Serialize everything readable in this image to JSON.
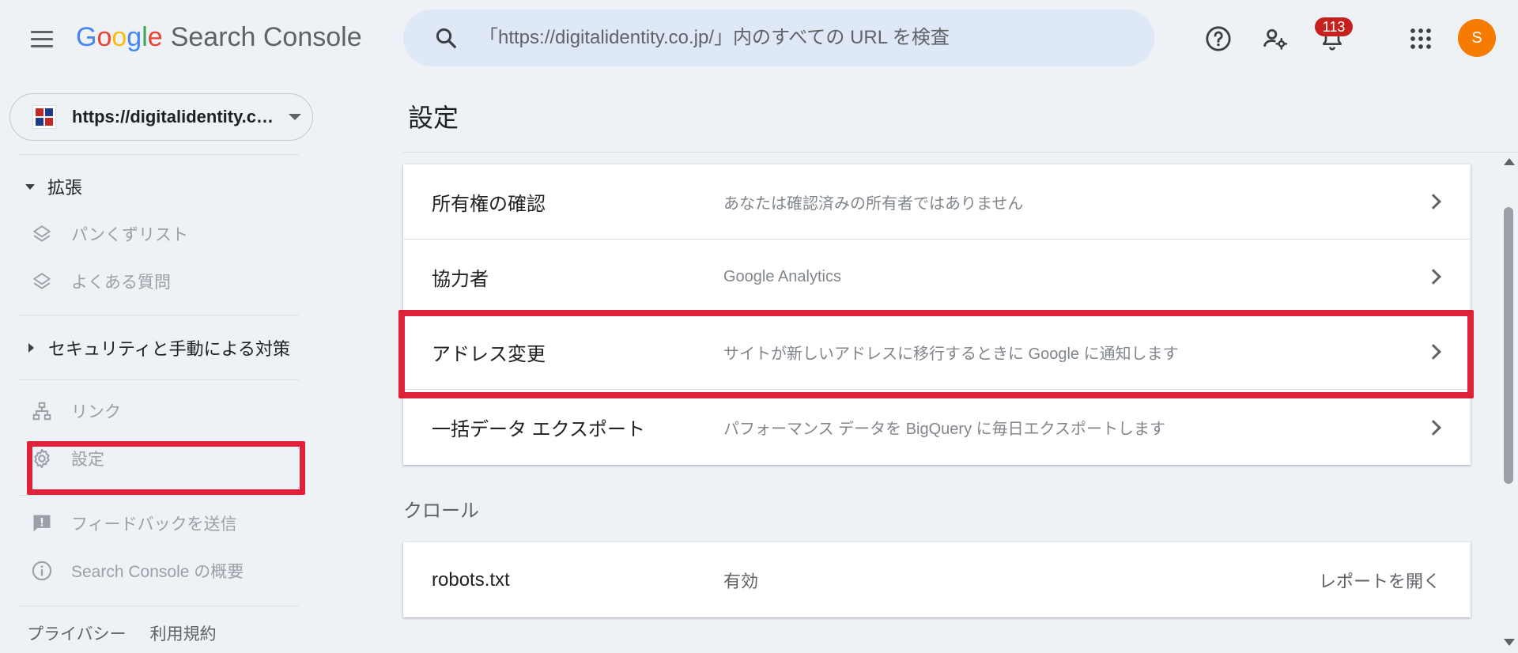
{
  "header": {
    "logo_google": [
      "G",
      "o",
      "o",
      "g",
      "l",
      "e"
    ],
    "product_name": "Search Console",
    "search_placeholder": "「https://digitalidentity.co.jp/」内のすべての URL を検査",
    "notification_count": "113",
    "avatar_initial": "S",
    "icons": [
      "menu-icon",
      "search-icon",
      "help-icon",
      "manage-users-icon",
      "notifications-icon",
      "apps-grid-icon"
    ]
  },
  "sidebar": {
    "property_label": "https://digitalidentity.co...",
    "sections": {
      "enhancements": {
        "label": "拡張",
        "items": [
          {
            "label": "パンくずリスト",
            "icon": "layers-icon"
          },
          {
            "label": "よくある質問",
            "icon": "layers-icon"
          }
        ]
      },
      "security": {
        "label": "セキュリティと手動による対策"
      }
    },
    "items": [
      {
        "label": "リンク",
        "icon": "links-icon"
      },
      {
        "label": "設定",
        "icon": "gear-icon"
      },
      {
        "label": "フィードバックを送信",
        "icon": "feedback-icon"
      },
      {
        "label": "Search Console の概要",
        "icon": "info-icon"
      }
    ],
    "footer": {
      "privacy": "プライバシー",
      "terms": "利用規約"
    }
  },
  "main": {
    "title": "設定",
    "general_rows": [
      {
        "label": "所有権の確認",
        "desc": "あなたは確認済みの所有者ではありません"
      },
      {
        "label": "協力者",
        "desc": "Google Analytics"
      },
      {
        "label": "アドレス変更",
        "desc": "サイトが新しいアドレスに移行するときに Google に通知します"
      },
      {
        "label": "一括データ エクスポート",
        "desc": "パフォーマンス データを BigQuery に毎日エクスポートします"
      }
    ],
    "crawl_section_label": "クロール",
    "crawl_rows": [
      {
        "label": "robots.txt",
        "desc": "有効",
        "link": "レポートを開く"
      }
    ]
  },
  "colors": {
    "highlight": "#e0213a",
    "background": "#eef2f7",
    "search_bg": "#dfe8f6",
    "avatar": "#f57c00",
    "badge": "#c5221f"
  }
}
